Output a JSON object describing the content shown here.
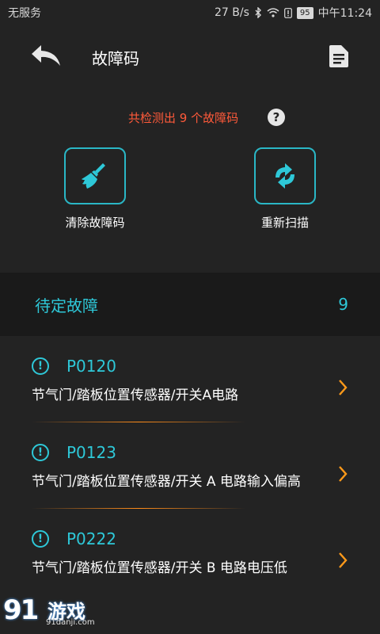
{
  "status_bar": {
    "carrier": "无服务",
    "net_speed": "27 B/s",
    "battery": "95",
    "time": "中午11:24"
  },
  "header": {
    "title": "故障码",
    "back_icon": "back-arrow-icon",
    "report_icon": "document-icon"
  },
  "summary": {
    "count_text": "共检测出 9 个故障码",
    "help_symbol": "?",
    "actions": [
      {
        "label": "清除故障码",
        "icon": "broom-icon"
      },
      {
        "label": "重新扫描",
        "icon": "refresh-icon"
      }
    ]
  },
  "pending": {
    "title": "待定故障",
    "count": "9"
  },
  "faults": [
    {
      "code": "P0120",
      "desc": "节气门/踏板位置传感器/开关A电路"
    },
    {
      "code": "P0123",
      "desc": "节气门/踏板位置传感器/开关 A 电路输入偏高"
    },
    {
      "code": "P0222",
      "desc": "节气门/踏板位置传感器/开关 B 电路电压低"
    }
  ],
  "watermark": {
    "digits": "91",
    "brand": "游戏",
    "url": "91danji.com"
  },
  "colors": {
    "accent": "#2ec8d8",
    "warning_text": "#ff5a3a",
    "chevron": "#ff9a1a",
    "background": "#232323"
  }
}
